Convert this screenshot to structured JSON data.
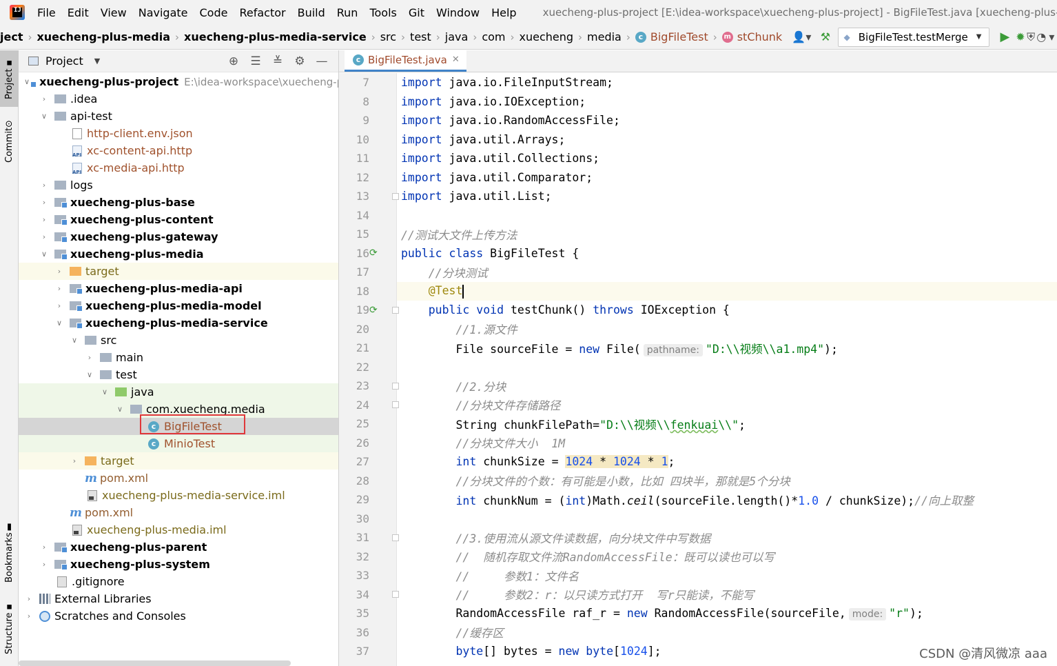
{
  "app_logo_text": "IJ",
  "menu": [
    "File",
    "Edit",
    "View",
    "Navigate",
    "Code",
    "Refactor",
    "Build",
    "Run",
    "Tools",
    "Git",
    "Window",
    "Help"
  ],
  "window_title": "xuecheng-plus-project [E:\\idea-workspace\\xuecheng-plus-project] - BigFileTest.java [xuecheng-plus-media-s",
  "breadcrumbs": {
    "c0": "ject",
    "c1": "xuecheng-plus-media",
    "c2": "xuecheng-plus-media-service",
    "c3": "src",
    "c4": "test",
    "c5": "java",
    "c6": "com",
    "c7": "xuecheng",
    "c8": "media",
    "c9": "BigFileTest",
    "c10": "stChunk"
  },
  "run_config": "BigFileTest.testMerge",
  "left_strip": {
    "project": "Project",
    "commit": "Commit",
    "bookmarks": "Bookmarks",
    "structure": "Structure"
  },
  "project_panel": {
    "title": "Project",
    "tree": [
      {
        "label": "xuecheng-plus-project",
        "extra": "E:\\idea-workspace\\xuecheng-pl"
      },
      {
        "label": ".idea"
      },
      {
        "label": "api-test"
      },
      {
        "label": "http-client.env.json"
      },
      {
        "label": "xc-content-api.http"
      },
      {
        "label": "xc-media-api.http"
      },
      {
        "label": "logs"
      },
      {
        "label": "xuecheng-plus-base"
      },
      {
        "label": "xuecheng-plus-content"
      },
      {
        "label": "xuecheng-plus-gateway"
      },
      {
        "label": "xuecheng-plus-media"
      },
      {
        "label": "target"
      },
      {
        "label": "xuecheng-plus-media-api"
      },
      {
        "label": "xuecheng-plus-media-model"
      },
      {
        "label": "xuecheng-plus-media-service"
      },
      {
        "label": "src"
      },
      {
        "label": "main"
      },
      {
        "label": "test"
      },
      {
        "label": "java"
      },
      {
        "label": "com.xuecheng.media"
      },
      {
        "label": "BigFileTest"
      },
      {
        "label": "MinioTest"
      },
      {
        "label": "target"
      },
      {
        "label": "pom.xml"
      },
      {
        "label": "xuecheng-plus-media-service.iml"
      },
      {
        "label": "pom.xml"
      },
      {
        "label": "xuecheng-plus-media.iml"
      },
      {
        "label": "xuecheng-plus-parent"
      },
      {
        "label": "xuecheng-plus-system"
      },
      {
        "label": ".gitignore"
      },
      {
        "label": "External Libraries"
      },
      {
        "label": "Scratches and Consoles"
      }
    ]
  },
  "editor": {
    "tab": "BigFileTest.java",
    "code": {
      "l7": {
        "n": "7",
        "p1": "java.io.FileInputStream;"
      },
      "l8": {
        "n": "8",
        "p1": "java.io.IOException;"
      },
      "l9": {
        "n": "9",
        "p1": "java.io.RandomAccessFile;"
      },
      "l10": {
        "n": "10",
        "p1": "java.util.Arrays;"
      },
      "l11": {
        "n": "11",
        "p1": "java.util.Collections;"
      },
      "l12": {
        "n": "12",
        "p1": "java.util.Comparator;"
      },
      "l13": {
        "n": "13",
        "p1": "java.util.List;"
      },
      "l14": {
        "n": "14"
      },
      "l15": {
        "n": "15",
        "c": "//测试大文件上传方法"
      },
      "l16": {
        "n": "16",
        "p1": " BigFileTest {"
      },
      "l17": {
        "n": "17",
        "c": "//分块测试"
      },
      "l18": {
        "n": "18",
        "a": "@Test"
      },
      "l19": {
        "n": "19",
        "p1": " testChunk() ",
        "p2": " IOException {"
      },
      "l20": {
        "n": "20",
        "c": "//1.源文件"
      },
      "l21": {
        "n": "21",
        "p1": "File sourceFile = ",
        "p2": " File(",
        "hint": "pathname:",
        "s": "\"D:\\\\视频\\\\a1.mp4\"",
        "p3": ");"
      },
      "l22": {
        "n": "22"
      },
      "l23": {
        "n": "23",
        "c": "//2.分块"
      },
      "l24": {
        "n": "24",
        "c": "//分块文件存储路径"
      },
      "l25": {
        "n": "25",
        "p1": "String chunkFilePath=",
        "s1": "\"D:\\\\视频\\\\",
        "s2": "fenkuai",
        "s3": "\\\\\"",
        "p2": ";"
      },
      "l26": {
        "n": "26",
        "c": "//分块文件大小  1M"
      },
      "l27": {
        "n": "27",
        "p1": " chunkSize = ",
        "n1": "1024",
        "op1": " * ",
        "n2": "1024",
        "op2": " * ",
        "n3": "1",
        "p2": ";"
      },
      "l28": {
        "n": "28",
        "c": "//分块文件的个数：有可能是小数，比如 四块半，那就是5个分块"
      },
      "l29": {
        "n": "29",
        "p1": " chunkNum = (",
        "p2": ")Math.",
        "f": "ceil",
        "p3": "(sourceFile.length()*",
        "n1": "1.0",
        "p4": " / chunkSize);",
        "c": "//向上取整"
      },
      "l30": {
        "n": "30"
      },
      "l31": {
        "n": "31",
        "c": "//3.使用流从源文件读数据，向分块文件中写数据"
      },
      "l32": {
        "n": "32",
        "c": "//  随机存取文件流RandomAccessFile：既可以读也可以写"
      },
      "l33": {
        "n": "33",
        "c": "//     参数1：文件名"
      },
      "l34": {
        "n": "34",
        "c": "//     参数2：r：以只读方式打开  写r只能读，不能写"
      },
      "l35": {
        "n": "35",
        "p1": "RandomAccessFile raf_r = ",
        "p2": " RandomAccessFile(sourceFile,",
        "hint": "mode:",
        "s": "\"r\"",
        "p3": ");"
      },
      "l36": {
        "n": "36",
        "c": "//缓存区"
      },
      "l37": {
        "n": "37",
        "p1": "[] bytes = ",
        "p2": " ",
        "p3": "[",
        "n1": "1024",
        "p4": "];"
      }
    },
    "keywords": {
      "import": "import",
      "public": "public",
      "class": "class",
      "void": "void",
      "throws": "throws",
      "new": "new",
      "int": "int",
      "byte": "byte"
    }
  },
  "watermark": "CSDN @清风微凉 aaa"
}
